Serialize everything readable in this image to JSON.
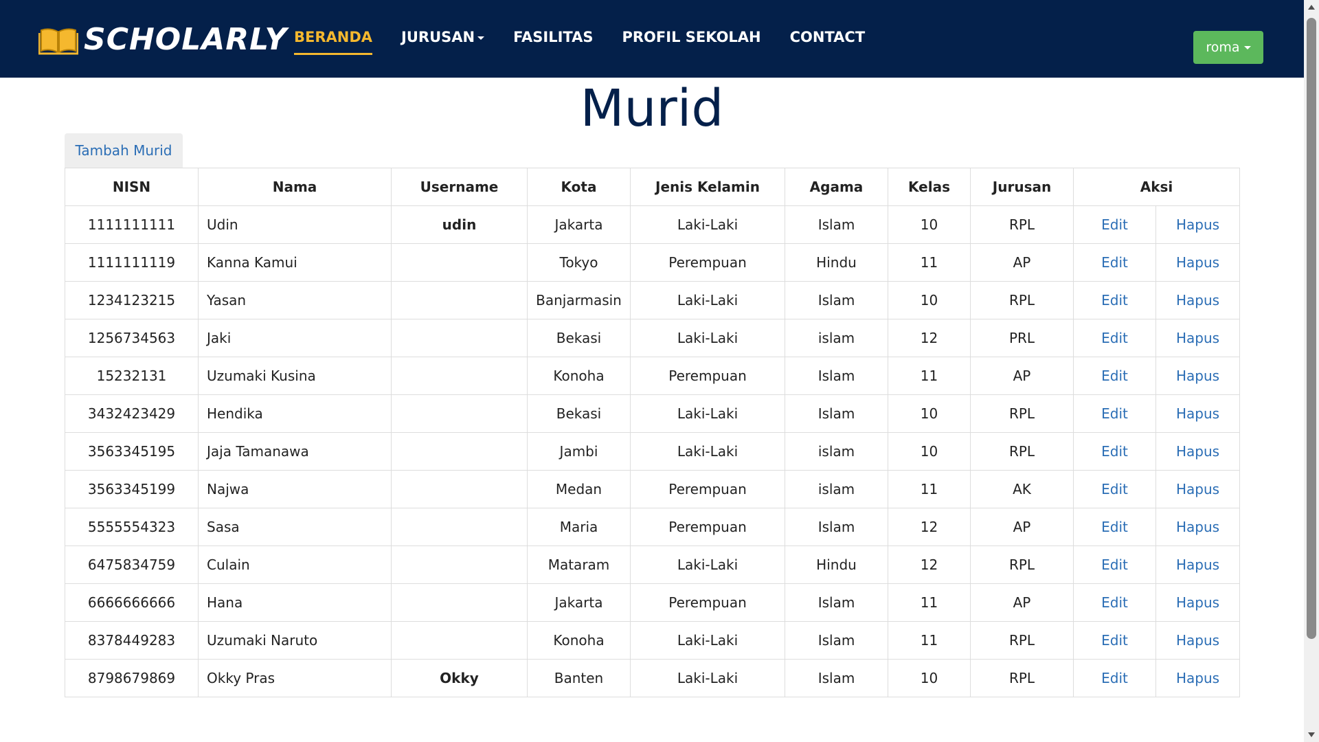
{
  "nav": {
    "brand": "SCHOLARLY",
    "items": [
      {
        "label": "BERANDA",
        "active": true,
        "dropdown": false
      },
      {
        "label": "JURUSAN",
        "active": false,
        "dropdown": true
      },
      {
        "label": "FASILITAS",
        "active": false,
        "dropdown": false
      },
      {
        "label": "PROFIL SEKOLAH",
        "active": false,
        "dropdown": false
      },
      {
        "label": "CONTACT",
        "active": false,
        "dropdown": false
      }
    ],
    "user": "roma"
  },
  "page": {
    "title": "Murid",
    "add_button": "Tambah Murid"
  },
  "table": {
    "headers": [
      "NISN",
      "Nama",
      "Username",
      "Kota",
      "Jenis Kelamin",
      "Agama",
      "Kelas",
      "Jurusan",
      "Aksi"
    ],
    "rows": [
      {
        "nisn": "1111111111",
        "nama": "Udin",
        "username": "udin",
        "kota": "Jakarta",
        "jk": "Laki-Laki",
        "agama": "Islam",
        "kelas": "10",
        "jurusan": "RPL",
        "edit": "Edit",
        "hapus": "Hapus"
      },
      {
        "nisn": "1111111119",
        "nama": "Kanna Kamui",
        "username": "",
        "kota": "Tokyo",
        "jk": "Perempuan",
        "agama": "Hindu",
        "kelas": "11",
        "jurusan": "AP",
        "edit": "Edit",
        "hapus": "Hapus"
      },
      {
        "nisn": "1234123215",
        "nama": "Yasan",
        "username": "",
        "kota": "Banjarmasin",
        "jk": "Laki-Laki",
        "agama": "Islam",
        "kelas": "10",
        "jurusan": "RPL",
        "edit": "Edit",
        "hapus": "Hapus"
      },
      {
        "nisn": "1256734563",
        "nama": "Jaki",
        "username": "",
        "kota": "Bekasi",
        "jk": "Laki-Laki",
        "agama": "islam",
        "kelas": "12",
        "jurusan": "PRL",
        "edit": "Edit",
        "hapus": "Hapus"
      },
      {
        "nisn": "15232131",
        "nama": "Uzumaki Kusina",
        "username": "",
        "kota": "Konoha",
        "jk": "Perempuan",
        "agama": "Islam",
        "kelas": "11",
        "jurusan": "AP",
        "edit": "Edit",
        "hapus": "Hapus"
      },
      {
        "nisn": "3432423429",
        "nama": "Hendika",
        "username": "",
        "kota": "Bekasi",
        "jk": "Laki-Laki",
        "agama": "Islam",
        "kelas": "10",
        "jurusan": "RPL",
        "edit": "Edit",
        "hapus": "Hapus"
      },
      {
        "nisn": "3563345195",
        "nama": "Jaja Tamanawa",
        "username": "",
        "kota": "Jambi",
        "jk": "Laki-Laki",
        "agama": "islam",
        "kelas": "10",
        "jurusan": "RPL",
        "edit": "Edit",
        "hapus": "Hapus"
      },
      {
        "nisn": "3563345199",
        "nama": "Najwa",
        "username": "",
        "kota": "Medan",
        "jk": "Perempuan",
        "agama": "islam",
        "kelas": "11",
        "jurusan": "AK",
        "edit": "Edit",
        "hapus": "Hapus"
      },
      {
        "nisn": "5555554323",
        "nama": "Sasa",
        "username": "",
        "kota": "Maria",
        "jk": "Perempuan",
        "agama": "Islam",
        "kelas": "12",
        "jurusan": "AP",
        "edit": "Edit",
        "hapus": "Hapus"
      },
      {
        "nisn": "6475834759",
        "nama": "Culain",
        "username": "",
        "kota": "Mataram",
        "jk": "Laki-Laki",
        "agama": "Hindu",
        "kelas": "12",
        "jurusan": "RPL",
        "edit": "Edit",
        "hapus": "Hapus"
      },
      {
        "nisn": "6666666666",
        "nama": "Hana",
        "username": "",
        "kota": "Jakarta",
        "jk": "Perempuan",
        "agama": "Islam",
        "kelas": "11",
        "jurusan": "AP",
        "edit": "Edit",
        "hapus": "Hapus"
      },
      {
        "nisn": "8378449283",
        "nama": "Uzumaki Naruto",
        "username": "",
        "kota": "Konoha",
        "jk": "Laki-Laki",
        "agama": "Islam",
        "kelas": "11",
        "jurusan": "RPL",
        "edit": "Edit",
        "hapus": "Hapus"
      },
      {
        "nisn": "8798679869",
        "nama": "Okky Pras",
        "username": "Okky",
        "kota": "Banten",
        "jk": "Laki-Laki",
        "agama": "Islam",
        "kelas": "10",
        "jurusan": "RPL",
        "edit": "Edit",
        "hapus": "Hapus"
      }
    ]
  },
  "colors": {
    "navbar": "#04204a",
    "active": "#f5b82e",
    "user_button": "#5cb85c",
    "link": "#2a6db5"
  },
  "icons": {
    "brand": "open-book-icon"
  }
}
